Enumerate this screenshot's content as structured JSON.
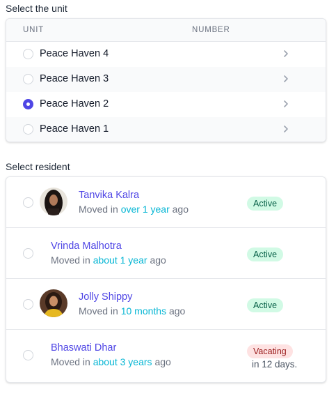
{
  "unit_section": {
    "label": "Select the unit",
    "columns": [
      "UNIT",
      "NUMBER"
    ],
    "units": [
      {
        "name": "Peace Haven 4",
        "selected": false
      },
      {
        "name": "Peace Haven 3",
        "selected": false
      },
      {
        "name": "Peace Haven 2",
        "selected": true
      },
      {
        "name": "Peace Haven 1",
        "selected": false
      }
    ]
  },
  "resident_section": {
    "label": "Select resident",
    "residents": [
      {
        "name": "Tanvika Kalra",
        "moved_prefix": "Moved in",
        "moved_when": "over 1 year",
        "moved_suffix": "ago",
        "status": "Active",
        "status_note": "",
        "avatar": "photo-dark-hair"
      },
      {
        "name": "Vrinda Malhotra",
        "moved_prefix": "Moved in",
        "moved_when": "about 1 year",
        "moved_suffix": "ago",
        "status": "Active",
        "status_note": "",
        "avatar": ""
      },
      {
        "name": "Jolly Shippy",
        "moved_prefix": "Moved in",
        "moved_when": "10 months",
        "moved_suffix": "ago",
        "status": "Active",
        "status_note": "",
        "avatar": "photo-yellow-outfit"
      },
      {
        "name": "Bhaswati Dhar",
        "moved_prefix": "Moved in",
        "moved_when": "about 3 years",
        "moved_suffix": "ago",
        "status": "Vacating",
        "status_note": "in 12 days.",
        "avatar": ""
      }
    ]
  },
  "colors": {
    "accent": "#4f46e5",
    "link_highlight": "#06b6d4",
    "active_badge_bg": "#d1fae5",
    "active_badge_text": "#065f46",
    "vacating_badge_bg": "#fee2e2",
    "vacating_badge_text": "#991b1b"
  }
}
